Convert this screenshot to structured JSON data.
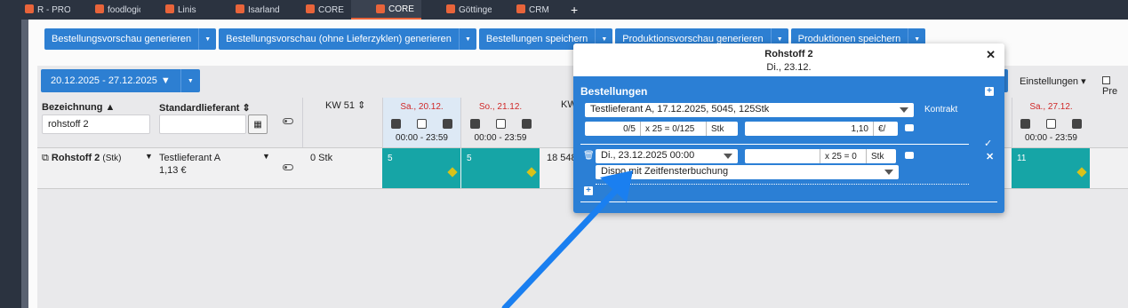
{
  "tabs": [
    {
      "label": "R - PRODU..."
    },
    {
      "label": "foodlogic"
    },
    {
      "label": "Linis"
    },
    {
      "label": "Isarland"
    },
    {
      "label": "CORE"
    },
    {
      "label": "CORE",
      "active": true
    },
    {
      "label": "Göttinger"
    },
    {
      "label": "CRM"
    }
  ],
  "toolbar": {
    "btn1": "Bestellungsvorschau generieren",
    "btn2": "Bestellungsvorschau (ohne Lieferzyklen) generieren",
    "btn3": "Bestellungen speichern",
    "btn4": "Produktionsvorschau generieren",
    "btn5": "Produktionen speichern"
  },
  "date_range": "20.12.2025 - 27.12.2025",
  "settings_label": "Einstellungen",
  "pre_label": "Pre",
  "table": {
    "col_bezeichnung": "Bezeichnung",
    "col_lieferant": "Standardlieferant",
    "filter_value": "rohstoff 2",
    "kw": "KW 51",
    "kw2": "KW",
    "days": [
      {
        "name": "Sa., 20.12.",
        "time": "00:00 - 23:59"
      },
      {
        "name": "So., 21.12.",
        "time": "00:00 - 23:59"
      },
      {
        "name": "Sa., 27.12.",
        "time": "00:00 - 23:59"
      }
    ],
    "row": {
      "name": "Rohstoff 2",
      "unit": "(Stk)",
      "supplier": "Testlieferant A",
      "price": "1,13 €",
      "stock": "0 Stk",
      "cell1": "5",
      "cell2": "5",
      "cell3": "18 548",
      "cell4": "11"
    }
  },
  "dialog": {
    "title": "Rohstoff 2",
    "subtitle": "Di., 23.12.",
    "section": "Bestellungen",
    "supplier_select": "Testlieferant A, 17.12.2025, 5045, 125Stk",
    "kontrakt": "Kontrakt",
    "qty": "0/5",
    "mult": "x 25 = 0/125",
    "unit": "Stk",
    "price": "1,10",
    "currency": "€/",
    "date_select": "Di., 23.12.2025 00:00",
    "mult2": "x 25 = 0",
    "unit2": "Stk",
    "dispo": "Dispo mit Zeitfensterbuchung"
  },
  "colors": {
    "accent": "#2d7fd2",
    "cyan": "#16a5a6",
    "arrow": "#1a7ff0"
  }
}
